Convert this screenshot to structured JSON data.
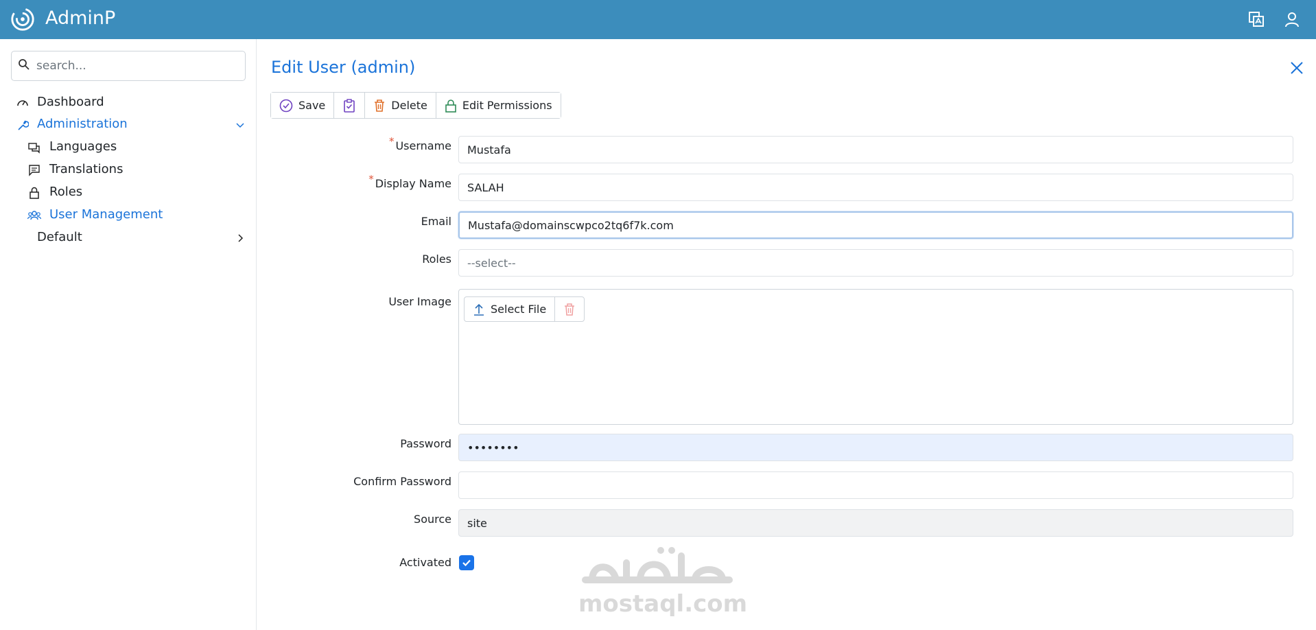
{
  "app": {
    "brand": "AdminP"
  },
  "header": {
    "icons": [
      "translate-icon",
      "user-icon"
    ]
  },
  "search": {
    "placeholder": "search..."
  },
  "sidebar": {
    "items": [
      {
        "label": "Dashboard",
        "icon": "dashboard-icon"
      },
      {
        "label": "Administration",
        "icon": "wrench-icon",
        "expanded": true
      },
      {
        "label": "Languages",
        "icon": "comments-icon"
      },
      {
        "label": "Translations",
        "icon": "message-icon"
      },
      {
        "label": "Roles",
        "icon": "lock-icon"
      },
      {
        "label": "User Management",
        "icon": "users-icon",
        "active": true
      },
      {
        "label": "Default",
        "icon": "chevron-right-icon"
      }
    ]
  },
  "page": {
    "title": "Edit User (admin)"
  },
  "toolbar": {
    "save_label": "Save",
    "delete_label": "Delete",
    "edit_permissions_label": "Edit Permissions"
  },
  "form": {
    "username": {
      "label": "Username",
      "value": "Mustafa"
    },
    "display_name": {
      "label": "Display Name",
      "value": "SALAH"
    },
    "email": {
      "label": "Email",
      "value": "Mustafa@domainscwpco2tq6f7k.com"
    },
    "roles": {
      "label": "Roles",
      "placeholder": "--select--"
    },
    "user_image": {
      "label": "User Image",
      "select_file_label": "Select File"
    },
    "password": {
      "label": "Password",
      "value": "••••••••"
    },
    "confirm_password": {
      "label": "Confirm Password",
      "value": ""
    },
    "source": {
      "label": "Source",
      "value": "site"
    },
    "activated": {
      "label": "Activated",
      "checked": true
    }
  },
  "watermark": {
    "text": "mostaql.com"
  },
  "colors": {
    "header": "#3c8dbc",
    "accent": "#1a73d9",
    "checkbox": "#1a73e8"
  }
}
